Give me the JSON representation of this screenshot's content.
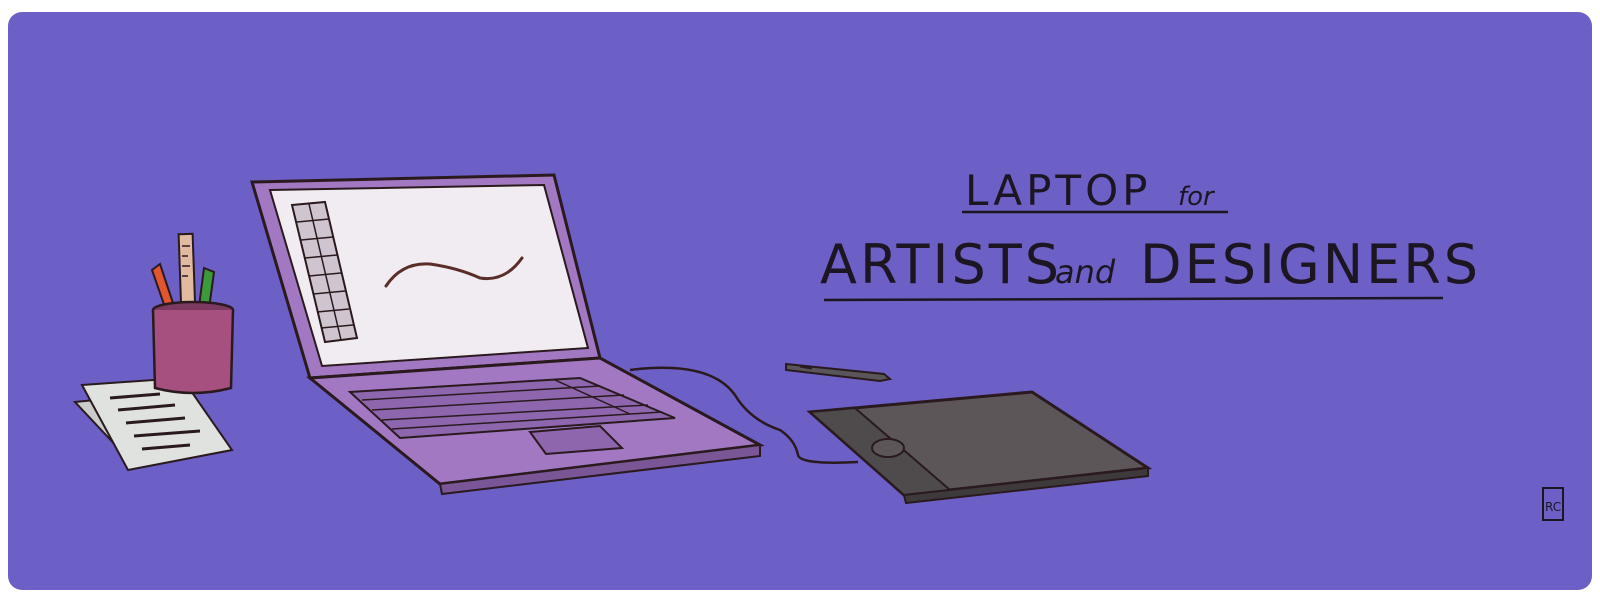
{
  "title": {
    "line1_main": "LAPTOP",
    "line1_connector": "for",
    "line2_a": "ARTISTS",
    "line2_connector": "and",
    "line2_b": "DESIGNERS"
  },
  "signature": "RC",
  "colors": {
    "background": "#6c5fc6",
    "outline": "#2a1a1e",
    "laptop_body": "#a278c2",
    "laptop_keys": "#8d66ad",
    "screen": "#f1ecf1",
    "toolbar": "#cfc5d1",
    "tablet": "#5c5658",
    "tablet_strip": "#4f4a4c",
    "pen": "#5a5558",
    "cup": "#a5507f",
    "ruler": "#e0bba0",
    "pencil_red": "#e1562f",
    "pencil_green": "#3b9a3a",
    "paper": "#dfe2df"
  },
  "icons": {
    "tool_palette": "tool-palette",
    "brush_stroke": "brush-stroke",
    "stylus": "stylus-pen",
    "tablet": "drawing-tablet",
    "cup": "pencil-cup",
    "papers": "paper-sheets"
  }
}
